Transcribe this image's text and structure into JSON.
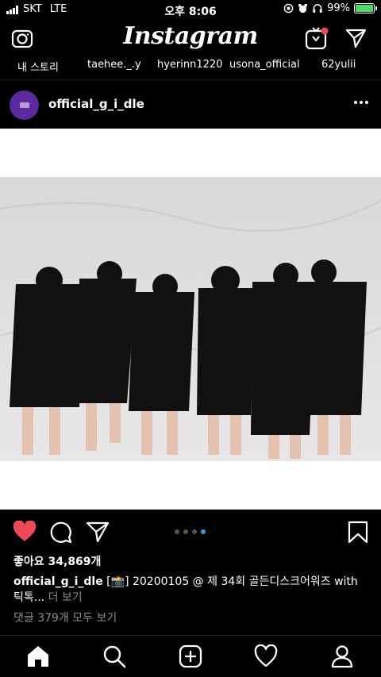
{
  "status_bar": {
    "carrier": "SKT",
    "network": "LTE",
    "time": "오후 8:06",
    "battery_percent": "99%",
    "battery_level": 0.99,
    "battery_color": "#4cd964"
  },
  "header": {
    "logo": "Instagram",
    "icons": [
      "camera-icon",
      "igtv-icon",
      "direct-message-icon"
    ],
    "igtv_badge_color": "#ed4956"
  },
  "stories": [
    {
      "label": "내 스토리"
    },
    {
      "label": "taehee._.y"
    },
    {
      "label": "hyerinn1220"
    },
    {
      "label": "usona_official"
    },
    {
      "label": "62yulii"
    }
  ],
  "post": {
    "username": "official_g_i_dle",
    "carousel_count": 4,
    "carousel_active_index": 3,
    "likes": "좋아요 34,869개",
    "caption_user": "official_g_i_dle",
    "caption_text": "[📸] 20200105 @ 제 34회 골든디스크어워즈 with 틱톡...",
    "caption_more": "더 보기",
    "comments": "댓글 379개 모두 보기",
    "liked": true,
    "like_color": "#ed4956"
  },
  "nav": {
    "items": [
      "home-icon",
      "search-icon",
      "new-post-icon",
      "activity-icon",
      "profile-icon"
    ]
  }
}
